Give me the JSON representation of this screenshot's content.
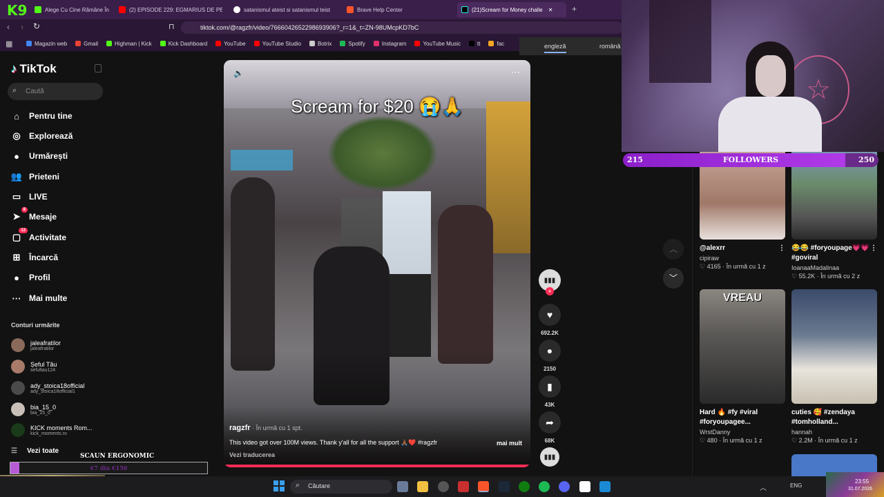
{
  "browser": {
    "tabs": [
      {
        "label": "Alege Cu Cine Rămâne În",
        "color": "#53fc18"
      },
      {
        "label": "(2) EPISODE 229: EGMARIUS DE PE T",
        "color": "#ff0000"
      },
      {
        "label": "satanismul ateist si satanismul teist",
        "color": "#ffffff"
      },
      {
        "label": "Brave Help Center",
        "color": "#fb542b"
      },
      {
        "label": "(21)Scream for Money challe",
        "color": "#000000"
      }
    ],
    "url": "tiktok.com/@ragzfr/video/7666042652298693906?_r=1&_t=ZN-98UMcpKD7bC",
    "bookmarks": [
      {
        "label": "Magazin web",
        "color": "#4285f4"
      },
      {
        "label": "Gmail",
        "color": "#ea4335"
      },
      {
        "label": "Highman | Kick",
        "color": "#53fc18"
      },
      {
        "label": "Kick Dashboard",
        "color": "#53fc18"
      },
      {
        "label": "YouTube",
        "color": "#ff0000"
      },
      {
        "label": "YouTube Studio",
        "color": "#ff0000"
      },
      {
        "label": "Botrix",
        "color": "#cccccc"
      },
      {
        "label": "Spotify",
        "color": "#1db954"
      },
      {
        "label": "Instagram",
        "color": "#e1306c"
      },
      {
        "label": "YouTube Music",
        "color": "#ff0000"
      },
      {
        "label": "tt",
        "color": "#000000"
      },
      {
        "label": "fac",
        "color": "#f5a623"
      }
    ],
    "translate": {
      "from": "engleză",
      "to": "română"
    }
  },
  "sidebar": {
    "logo": "TikTok",
    "search_placeholder": "Caută",
    "nav": [
      {
        "label": "Pentru tine",
        "icon": "home-icon",
        "glyph": "⌂"
      },
      {
        "label": "Explorează",
        "icon": "compass-icon",
        "glyph": "◎"
      },
      {
        "label": "Urmărești",
        "icon": "following-avatar-icon",
        "glyph": "●"
      },
      {
        "label": "Prieteni",
        "icon": "friends-icon",
        "glyph": "👥"
      },
      {
        "label": "LIVE",
        "icon": "live-icon",
        "glyph": "▭"
      },
      {
        "label": "Mesaje",
        "icon": "messages-icon",
        "glyph": "➤",
        "badge": "8"
      },
      {
        "label": "Activitate",
        "icon": "activity-icon",
        "glyph": "▢",
        "badge": "13"
      },
      {
        "label": "Încarcă",
        "icon": "upload-icon",
        "glyph": "⊞"
      },
      {
        "label": "Profil",
        "icon": "profile-icon",
        "glyph": "●"
      },
      {
        "label": "Mai multe",
        "icon": "more-icon",
        "glyph": "···"
      }
    ],
    "following_title": "Conturi urmărite",
    "following": [
      {
        "name": "jaleafratilor",
        "handle": "jaleafratilor"
      },
      {
        "name": "Șeful Tău",
        "handle": "sefultau124"
      },
      {
        "name": "ady_stoica18official",
        "handle": "ady_stoica18official1"
      },
      {
        "name": "bia_15_0",
        "handle": "bia_15_0"
      },
      {
        "name": "KICK moments Rom...",
        "handle": "kick_moments.ro"
      }
    ],
    "see_all": "Vezi toate"
  },
  "overlay": {
    "ergonomic_title": "SCAUN ERGONOMIC",
    "goal_text": "€7 din €150",
    "goal_progress": 0.047,
    "followers_label": "FOLLOWERS",
    "followers_current": "215",
    "followers_goal": "250",
    "followers_progress": 0.86
  },
  "video": {
    "overlay_text": "Scream for $20 😭🙏",
    "author": "ragzfr",
    "time": "În urmă cu 1 spt.",
    "description": "This video got over 100M views. Thank y'all for all the support 🙏🏾❤️ #ragzfr",
    "more": "mai mult",
    "translate": "Vezi traducerea",
    "likes": "692.2K",
    "comments": "2150",
    "saves": "43K",
    "shares": "68K"
  },
  "grid": [
    {
      "caption": "@alexrr",
      "author": "cipiraw",
      "likes": "4165",
      "time": "În urmă cu 1 z"
    },
    {
      "caption": "😂😂 #foryoupage💗💗 #goviral",
      "author": "IoanaaMadalinaa",
      "likes": "55.2K",
      "time": "În urmă cu 2 z"
    },
    {
      "caption": "Hard 🔥 #fy #viral #foryoupagee...",
      "author": "WrstDanny",
      "likes": "480",
      "time": "În urmă cu 1 z",
      "thumb_text": "VREAU"
    },
    {
      "caption": "cuties 🥰 #zendaya #tomholland...",
      "author": "hannah",
      "likes": "2.2M",
      "time": "În urmă cu 1 z"
    }
  ],
  "taskbar": {
    "search": "Căutare",
    "lang": "ENG",
    "time": "23:55",
    "date": "31.07.2026"
  }
}
